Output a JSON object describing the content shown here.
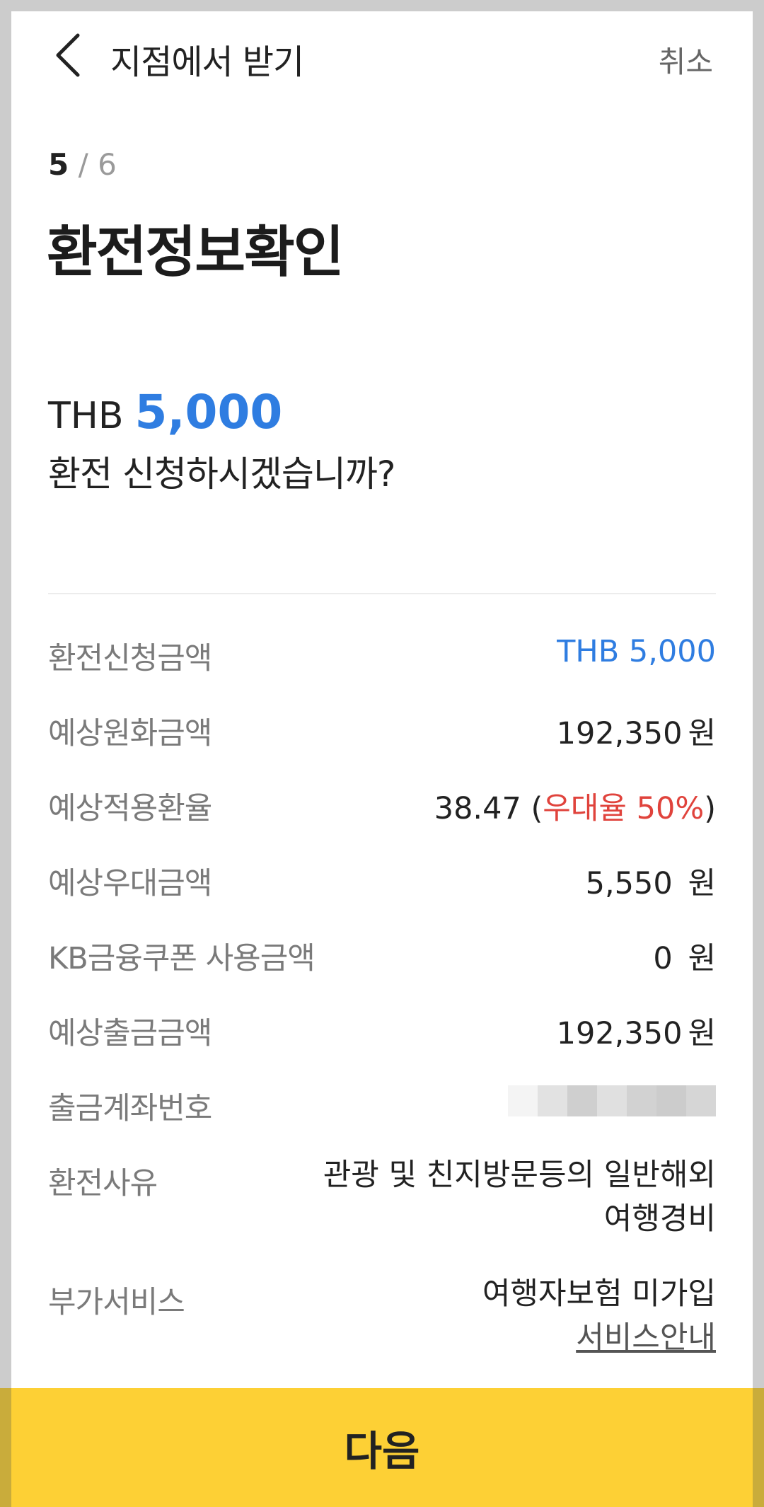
{
  "header": {
    "title": "지점에서 받기",
    "cancel_label": "취소"
  },
  "step": {
    "current": "5",
    "separator": "/",
    "total": "6"
  },
  "page_title": "환전정보확인",
  "summary": {
    "currency": "THB",
    "amount": "5,000",
    "question": "환전 신청하시겠습니까?"
  },
  "details": {
    "request_amount": {
      "label": "환전신청금액",
      "value": "THB 5,000"
    },
    "expected_krw": {
      "label": "예상원화금액",
      "value": "192,350",
      "unit": "원"
    },
    "expected_rate": {
      "label": "예상적용환율",
      "value": "38.47",
      "open": "(",
      "pref_label": "우대율",
      "pref_value": "50",
      "pref_unit": "%",
      "close": ")"
    },
    "expected_discount": {
      "label": "예상우대금액",
      "value": "5,550",
      "unit": "원"
    },
    "coupon": {
      "label": "KB금융쿠폰 사용금액",
      "value": "0",
      "unit": "원"
    },
    "expected_withdraw": {
      "label": "예상출금금액",
      "value": "192,350",
      "unit": "원"
    },
    "account": {
      "label": "출금계좌번호"
    },
    "reason": {
      "label": "환전사유",
      "value_line1": "관광 및 친지방문등의 일반해외",
      "value_line2": "여행경비"
    },
    "addon": {
      "label": "부가서비스",
      "value": "여행자보험 미가입",
      "link": "서비스안내"
    }
  },
  "next_label": "다음",
  "colors": {
    "accent_blue": "#2f7de1",
    "accent_red": "#e0433c",
    "button_yellow": "#fdd035"
  }
}
